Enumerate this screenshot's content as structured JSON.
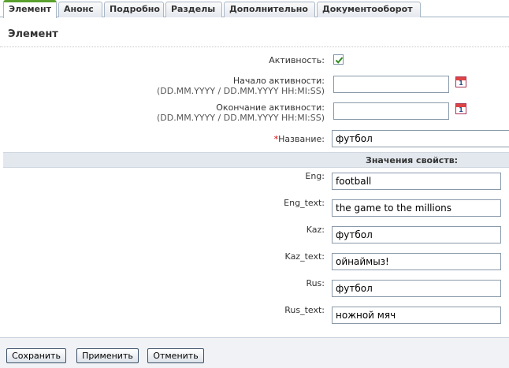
{
  "tabs": [
    {
      "label": "Элемент",
      "active": true
    },
    {
      "label": "Анонс",
      "active": false
    },
    {
      "label": "Подробно",
      "active": false
    },
    {
      "label": "Разделы",
      "active": false
    },
    {
      "label": "Дополнительно",
      "active": false
    },
    {
      "label": "Документооборот",
      "active": false
    }
  ],
  "section_title": "Элемент",
  "form": {
    "active_label": "Активность:",
    "active_checked": true,
    "start_label": "Начало активности:",
    "start_hint": "(DD.MM.YYYY / DD.MM.YYYY HH:MI:SS)",
    "start_value": "",
    "end_label": "Окончание активности:",
    "end_hint": "(DD.MM.YYYY / DD.MM.YYYY HH:MI:SS)",
    "end_value": "",
    "calendar_icon_text": "1",
    "name_required_mark": "*",
    "name_label": "Название:",
    "name_value": "футбол"
  },
  "properties": {
    "header": "Значения свойств:",
    "items": [
      {
        "label": "Eng:",
        "value": "football"
      },
      {
        "label": "Eng_text:",
        "value": "the game to the millions"
      },
      {
        "label": "Kaz:",
        "value": "футбол"
      },
      {
        "label": "Kaz_text:",
        "value": "ойнаймыз!"
      },
      {
        "label": "Rus:",
        "value": "футбол"
      },
      {
        "label": "Rus_text:",
        "value": "ножной мяч"
      }
    ]
  },
  "buttons": {
    "save": "Сохранить",
    "apply": "Применить",
    "cancel": "Отменить"
  },
  "colors": {
    "active_tab_accent": "#5aa02c",
    "required_mark": "#d40000",
    "checkbox_check": "#2e8b1e"
  }
}
